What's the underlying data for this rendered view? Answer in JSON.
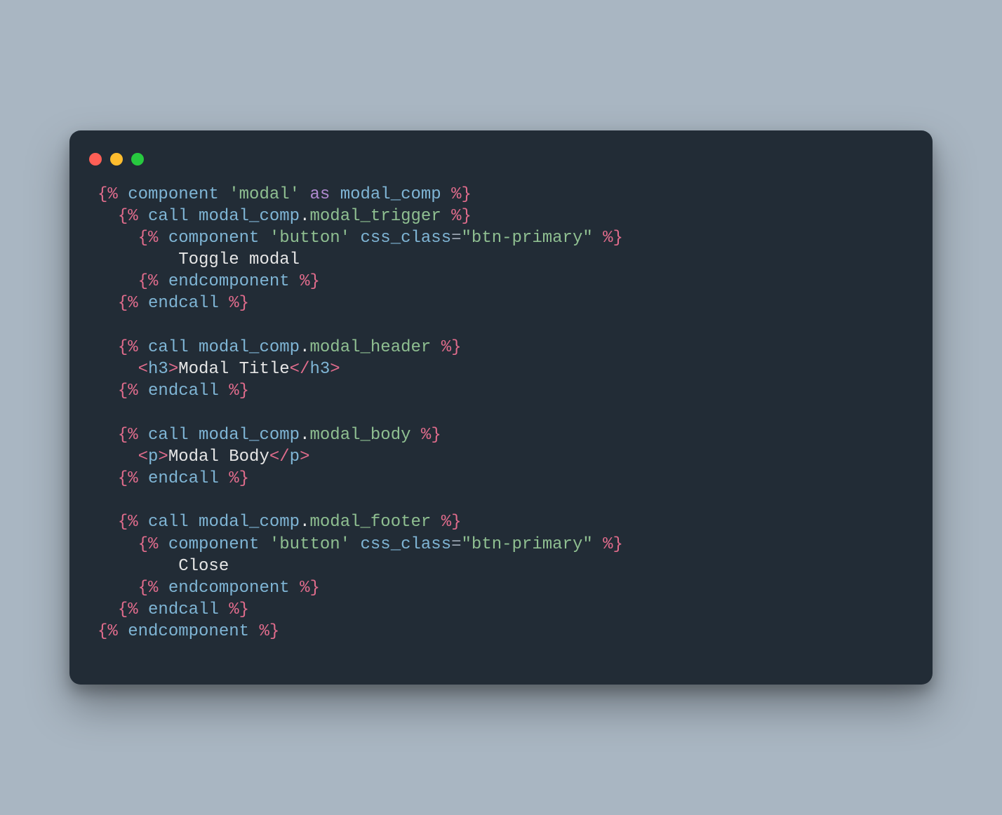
{
  "code": {
    "l1": {
      "a": "{%",
      "b": " component ",
      "c": "'modal'",
      "d": " as ",
      "e": "modal_comp ",
      "f": "%}"
    },
    "l2": {
      "a": "{%",
      "b": " call ",
      "c": "modal_comp",
      "d": ".",
      "e": "modal_trigger ",
      "f": "%}"
    },
    "l3": {
      "a": "{%",
      "b": " component ",
      "c": "'button'",
      "d": " css_class",
      "e": "=",
      "f": "\"btn-primary\"",
      "g": " ",
      "h": "%}"
    },
    "l4": {
      "a": "Toggle modal"
    },
    "l5": {
      "a": "{%",
      "b": " endcomponent ",
      "c": "%}"
    },
    "l6": {
      "a": "{%",
      "b": " endcall ",
      "c": "%}"
    },
    "l7": {
      "a": "{%",
      "b": " call ",
      "c": "modal_comp",
      "d": ".",
      "e": "modal_header ",
      "f": "%}"
    },
    "l8": {
      "a": "<",
      "b": "h3",
      "c": ">",
      "d": "Modal Title",
      "e": "</",
      "f": "h3",
      "g": ">"
    },
    "l9": {
      "a": "{%",
      "b": " endcall ",
      "c": "%}"
    },
    "l10": {
      "a": "{%",
      "b": " call ",
      "c": "modal_comp",
      "d": ".",
      "e": "modal_body ",
      "f": "%}"
    },
    "l11": {
      "a": "<",
      "b": "p",
      "c": ">",
      "d": "Modal Body",
      "e": "</",
      "f": "p",
      "g": ">"
    },
    "l12": {
      "a": "{%",
      "b": " endcall ",
      "c": "%}"
    },
    "l13": {
      "a": "{%",
      "b": " call ",
      "c": "modal_comp",
      "d": ".",
      "e": "modal_footer ",
      "f": "%}"
    },
    "l14": {
      "a": "{%",
      "b": " component ",
      "c": "'button'",
      "d": " css_class",
      "e": "=",
      "f": "\"btn-primary\"",
      "g": " ",
      "h": "%}"
    },
    "l15": {
      "a": "Close"
    },
    "l16": {
      "a": "{%",
      "b": " endcomponent ",
      "c": "%}"
    },
    "l17": {
      "a": "{%",
      "b": " endcall ",
      "c": "%}"
    },
    "l18": {
      "a": "{%",
      "b": " endcomponent ",
      "c": "%}"
    }
  }
}
